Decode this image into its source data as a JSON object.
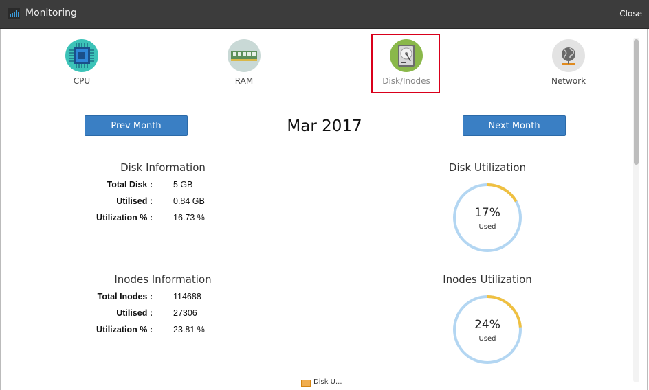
{
  "window": {
    "title": "Monitoring",
    "close_label": "Close",
    "icon": "bar-chart-icon"
  },
  "tabs": [
    {
      "label": "CPU",
      "icon": "cpu-chip-icon",
      "color": "#3cc3b8"
    },
    {
      "label": "RAM",
      "icon": "ram-module-icon",
      "color": "#c9d9d6"
    },
    {
      "label": "Disk/Inodes",
      "icon": "hard-disk-icon",
      "color": "#8ab84a",
      "active": true
    },
    {
      "label": "Network",
      "icon": "globe-icon",
      "color": "#e3e3e3"
    }
  ],
  "nav": {
    "prev_label": "Prev Month",
    "next_label": "Next Month",
    "month": "Mar 2017"
  },
  "disk_info": {
    "title": "Disk Information",
    "rows": [
      {
        "label": "Total Disk :",
        "value": "5 GB"
      },
      {
        "label": "Utilised :",
        "value": "0.84 GB"
      },
      {
        "label": "Utilization % :",
        "value": "16.73 %"
      }
    ]
  },
  "inodes_info": {
    "title": "Inodes Information",
    "rows": [
      {
        "label": "Total Inodes :",
        "value": "114688"
      },
      {
        "label": "Utilised :",
        "value": "27306"
      },
      {
        "label": "Utilization % :",
        "value": "23.81 %"
      }
    ]
  },
  "disk_util": {
    "title": "Disk Utilization",
    "percent_text": "17%",
    "used_label": "Used",
    "fraction": 0.1673
  },
  "inodes_util": {
    "title": "Inodes Utilization",
    "percent_text": "24%",
    "used_label": "Used",
    "fraction": 0.2381
  },
  "colors": {
    "used": "#f0c040",
    "free": "#b3d6f2",
    "button": "#3a7fc4",
    "highlight": "#d9001b"
  },
  "legend": {
    "label": "Disk U..."
  }
}
